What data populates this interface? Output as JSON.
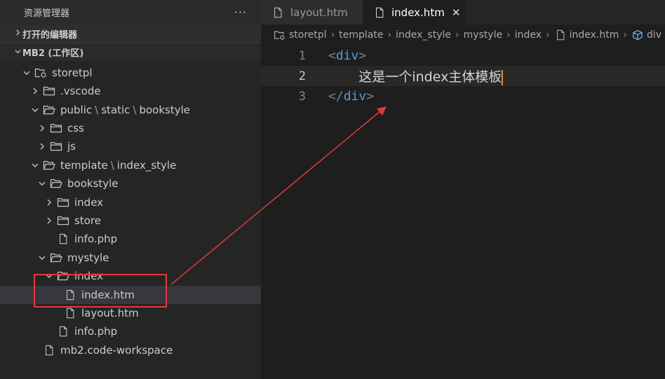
{
  "sidebar": {
    "title": "资源管理器",
    "more": "···",
    "open_editors": "打开的编辑器",
    "workspace": "MB2 (工作区)",
    "tree": [
      {
        "label": "storetpl"
      },
      {
        "label": ".vscode"
      },
      {
        "label": "public",
        "sep": "\\",
        "label2": "static",
        "label3": "bookstyle"
      },
      {
        "label": "css"
      },
      {
        "label": "js"
      },
      {
        "label": "template",
        "sep": "\\",
        "label2": "index_style"
      },
      {
        "label": "bookstyle"
      },
      {
        "label": "index"
      },
      {
        "label": "store"
      },
      {
        "label": "info.php"
      },
      {
        "label": "mystyle"
      },
      {
        "label": "index"
      },
      {
        "label": "index.htm"
      },
      {
        "label": "layout.htm"
      },
      {
        "label": "info.php"
      },
      {
        "label": "mb2.code-workspace"
      }
    ]
  },
  "tabs": [
    {
      "label": "layout.htm"
    },
    {
      "label": "index.htm",
      "close": "✕"
    }
  ],
  "breadcrumb": [
    "storetpl",
    "template",
    "index_style",
    "mystyle",
    "index",
    "index.htm",
    "div"
  ],
  "editor": {
    "line_numbers": [
      "1",
      "2",
      "3"
    ],
    "open_tag": "div",
    "content": "这是一个index主体模板",
    "close_tag": "div"
  },
  "colors": {
    "annotation": "#e53935",
    "tag": "#569cd6",
    "cursor": "#e58b3a"
  }
}
